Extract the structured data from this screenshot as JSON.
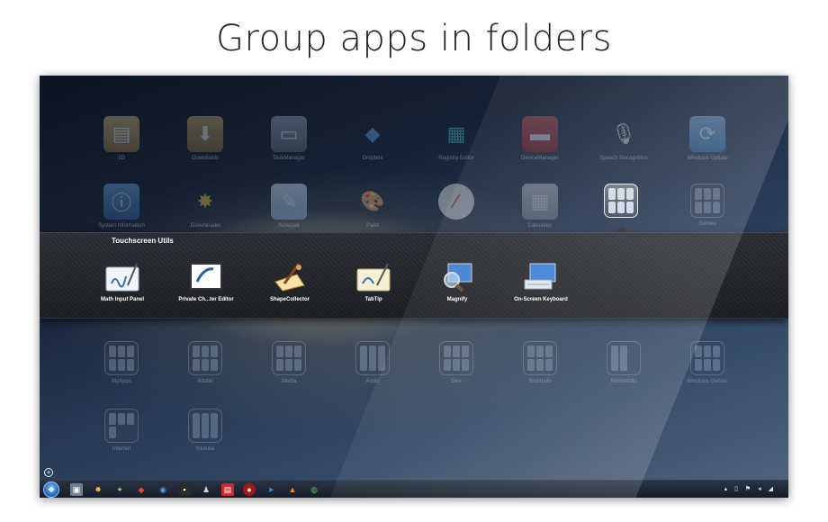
{
  "headline": "Group apps in folders",
  "background_apps": [
    {
      "label": "3D",
      "icon": "folder-icon",
      "color": "#b8a16a"
    },
    {
      "label": "Downloads",
      "icon": "download-folder-icon",
      "color": "#9a8a55"
    },
    {
      "label": "TaskManager",
      "icon": "monitor-icon",
      "color": "#7f93a6"
    },
    {
      "label": "Dropbox",
      "icon": "dropbox-icon",
      "color": "#4a8fd6"
    },
    {
      "label": "Registry Editor",
      "icon": "registry-icon",
      "color": "#3aa3a8"
    },
    {
      "label": "DeviceManager",
      "icon": "toolbox-icon",
      "color": "#b0383a"
    },
    {
      "label": "Speech Recognition",
      "icon": "microphone-icon",
      "color": "#bfc6cf"
    },
    {
      "label": "Windows Update",
      "icon": "windows-update-icon",
      "color": "#5fa0d8"
    },
    {
      "label": "System Information",
      "icon": "system-info-icon",
      "color": "#4a7fbf"
    },
    {
      "label": "JDownloader",
      "icon": "jdownloader-icon",
      "color": "#d0b230"
    },
    {
      "label": "Notepad",
      "icon": "notepad-icon",
      "color": "#9fc4e6"
    },
    {
      "label": "Paint",
      "icon": "palette-icon",
      "color": "#d9b377"
    },
    {
      "label": "",
      "icon": "drawing-icon",
      "color": "#e0e0e0"
    },
    {
      "label": "Calculator",
      "icon": "calculator-icon",
      "color": "#a9b3bd"
    },
    {
      "label": "Games",
      "icon": "games-folder-icon",
      "color": "#8a9bb0"
    }
  ],
  "lower_folders": [
    {
      "label": "MyApps"
    },
    {
      "label": "Adobe"
    },
    {
      "label": "Media"
    },
    {
      "label": "Audio"
    },
    {
      "label": "Dev"
    },
    {
      "label": "Shortcuts"
    },
    {
      "label": "Nonmetals"
    },
    {
      "label": "Windows Games"
    },
    {
      "label": "Internet"
    },
    {
      "label": "Youtube"
    }
  ],
  "folder_panel": {
    "title": "Touchscreen Utils",
    "apps": [
      {
        "label": "Math Input Panel",
        "icon": "math-input-icon"
      },
      {
        "label": "Private Ch...ter Editor",
        "icon": "private-character-editor-icon"
      },
      {
        "label": "ShapeCollector",
        "icon": "shape-collector-icon"
      },
      {
        "label": "TabTip",
        "icon": "tabtip-icon"
      },
      {
        "label": "Magnify",
        "icon": "magnifier-icon"
      },
      {
        "label": "On-Screen Keyboard",
        "icon": "keyboard-icon"
      }
    ]
  },
  "taskbar": {
    "items": [
      {
        "icon": "picture-icon",
        "color": "#6f7f90"
      },
      {
        "icon": "jdownloader-icon",
        "color": "#c9a62b"
      },
      {
        "icon": "launchpad-icon",
        "color": "#7fb24a"
      },
      {
        "icon": "rocket-icon",
        "color": "#d83b2b"
      },
      {
        "icon": "browser-globe-icon",
        "color": "#3f7fcf"
      },
      {
        "icon": "media-icon",
        "color": "#333333"
      },
      {
        "icon": "penguin-icon",
        "color": "#555555"
      },
      {
        "icon": "document-red-icon",
        "color": "#cc2a2a"
      },
      {
        "icon": "record-icon",
        "color": "#a01818"
      },
      {
        "icon": "arrow-icon",
        "color": "#2a6ed8"
      },
      {
        "icon": "vlc-icon",
        "color": "#f08a1c"
      },
      {
        "icon": "chrome-icon",
        "color": "#3aa34a"
      }
    ],
    "tray_text": "▴ ▯ ⚑ ◂ ◢"
  }
}
